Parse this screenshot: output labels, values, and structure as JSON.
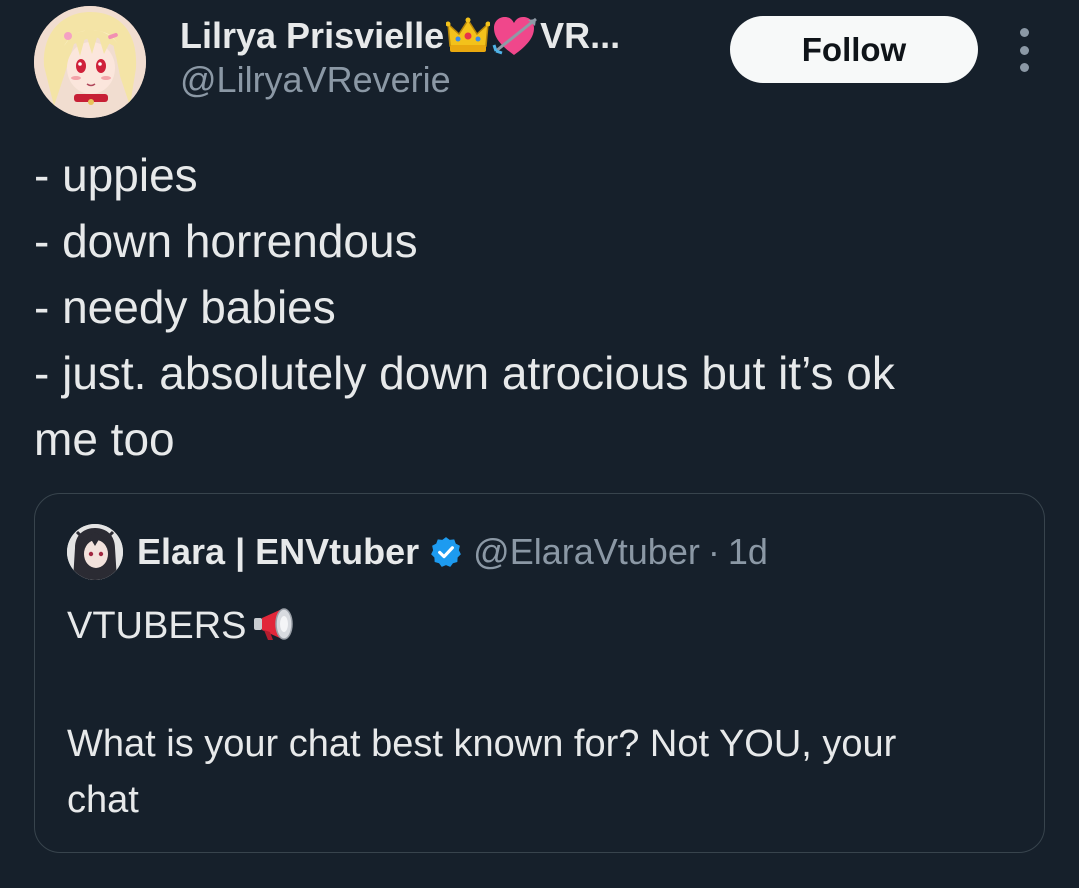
{
  "author": {
    "display_name": "Lilrya Prisvielle",
    "display_name_suffix": "VR...",
    "handle": "@LilryaVReverie",
    "avatar_icon": "anime-avatar-icon",
    "name_emojis": [
      "crown-icon",
      "heart-with-arrow-icon"
    ]
  },
  "actions": {
    "follow_label": "Follow",
    "more_icon": "more-options-icon"
  },
  "post": {
    "lines": [
      "- uppies",
      "- down horrendous",
      "- needy babies",
      "- just. absolutely down atrocious but it’s ok",
      "me too"
    ]
  },
  "quote": {
    "display_name": "Elara | ENVtuber",
    "verified_icon": "verified-badge-icon",
    "handle": "@ElaraVtuber",
    "separator": "·",
    "time": "1d",
    "text_line1": "VTUBERS",
    "text_emoji": "megaphone-icon",
    "text_line2": "What is your chat best known for? Not YOU, your",
    "text_line3": "chat"
  },
  "colors": {
    "background": "#16202b",
    "text_primary": "#e7e9ea",
    "text_secondary": "#8b98a5",
    "border": "#38444d",
    "follow_bg": "#f7f9f9",
    "verified": "#1d9bf0"
  }
}
